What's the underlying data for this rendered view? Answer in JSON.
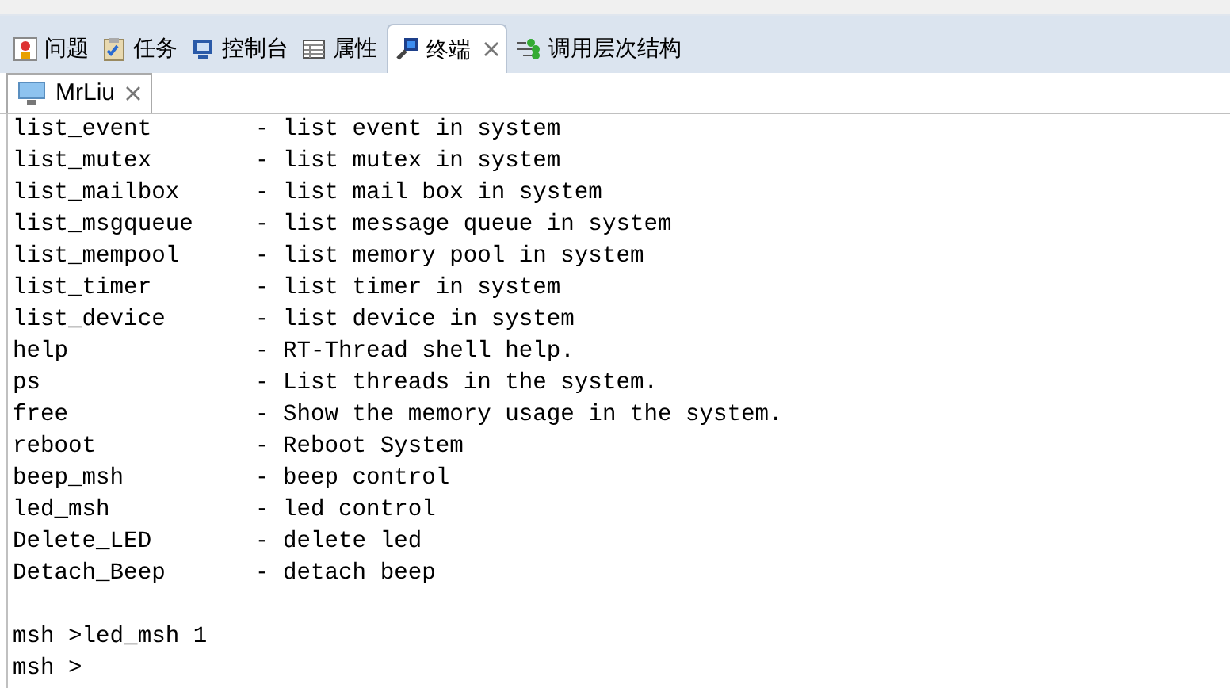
{
  "view_tabs": [
    {
      "label": "问题",
      "kind": "problems",
      "selected": false,
      "closable": false
    },
    {
      "label": "任务",
      "kind": "tasks",
      "selected": false,
      "closable": false
    },
    {
      "label": "控制台",
      "kind": "console",
      "selected": false,
      "closable": false
    },
    {
      "label": "属性",
      "kind": "properties",
      "selected": false,
      "closable": false
    },
    {
      "label": "终端",
      "kind": "terminal",
      "selected": true,
      "closable": true
    },
    {
      "label": "调用层次结构",
      "kind": "hierarchy",
      "selected": false,
      "closable": false
    }
  ],
  "session_tab": {
    "label": "MrLiu"
  },
  "terminal": {
    "commands": [
      {
        "command": "list_event",
        "description": "- list event in system"
      },
      {
        "command": "list_mutex",
        "description": "- list mutex in system"
      },
      {
        "command": "list_mailbox",
        "description": "- list mail box in system"
      },
      {
        "command": "list_msgqueue",
        "description": "- list message queue in system"
      },
      {
        "command": "list_mempool",
        "description": "- list memory pool in system"
      },
      {
        "command": "list_timer",
        "description": "- list timer in system"
      },
      {
        "command": "list_device",
        "description": "- list device in system"
      },
      {
        "command": "help",
        "description": "- RT-Thread shell help."
      },
      {
        "command": "ps",
        "description": "- List threads in the system."
      },
      {
        "command": "free",
        "description": "- Show the memory usage in the system."
      },
      {
        "command": "reboot",
        "description": "- Reboot System"
      },
      {
        "command": "beep_msh",
        "description": "- beep control"
      },
      {
        "command": "led_msh",
        "description": "- led control"
      },
      {
        "command": "Delete_LED",
        "description": "- delete led"
      },
      {
        "command": "Detach_Beep",
        "description": "- detach beep"
      }
    ],
    "prompt_lines": [
      "msh >led_msh 1",
      "msh >"
    ]
  }
}
